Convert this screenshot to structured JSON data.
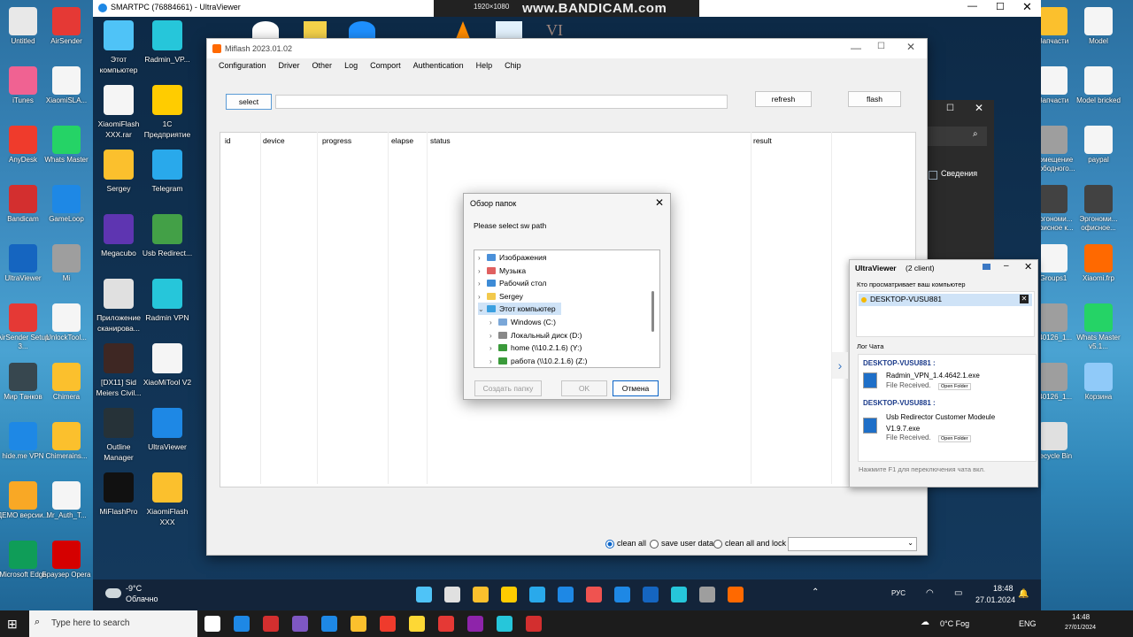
{
  "outer_desktop_left": [
    {
      "label": "Untitled",
      "color": "#e8e8e8"
    },
    {
      "label": "AirSender",
      "color": "#e53935"
    },
    {
      "label": "iTunes",
      "color": "#f06292"
    },
    {
      "label": "XiaomiSLA...",
      "color": "#f5f5f5"
    },
    {
      "label": "AnyDesk",
      "color": "#ef3b2c"
    },
    {
      "label": "Whats Master",
      "color": "#25d366"
    },
    {
      "label": "Bandicam",
      "color": "#d32f2f"
    },
    {
      "label": "GameLoop",
      "color": "#1e88e5"
    },
    {
      "label": "UltraViewer",
      "color": "#1565c0"
    },
    {
      "label": "Mi",
      "color": "#9e9e9e"
    },
    {
      "label": "AirSender Setup 3...",
      "color": "#e53935"
    },
    {
      "label": "UnlockTool...",
      "color": "#f5f5f5"
    },
    {
      "label": "Мир Танков",
      "color": "#37474f"
    },
    {
      "label": "Chimera",
      "color": "#fbc02d"
    },
    {
      "label": "hide.me VPN",
      "color": "#1e88e5"
    },
    {
      "label": "Chimerains...",
      "color": "#fbc02d"
    },
    {
      "label": "ДЕМО версии...",
      "color": "#f9a825"
    },
    {
      "label": "Mr_Auth_T...",
      "color": "#f5f5f5"
    },
    {
      "label": "Microsoft Edge",
      "color": "#0f9d58"
    },
    {
      "label": "Браузер Opera",
      "color": "#d50000"
    }
  ],
  "outer_desktop_right": [
    {
      "label": "Запчасти",
      "color": "#fbc02d"
    },
    {
      "label": "Model",
      "color": "#f5f5f5"
    },
    {
      "label": "Запчасти",
      "color": "#f5f5f5"
    },
    {
      "label": "Model bricked",
      "color": "#f5f5f5"
    },
    {
      "label": "Помещение свободного...",
      "color": "#9e9e9e"
    },
    {
      "label": "paypal",
      "color": "#f5f5f5"
    },
    {
      "label": "Эргономи... офисное к...",
      "color": "#424242"
    },
    {
      "label": "Эргономи... офисное...",
      "color": "#424242"
    },
    {
      "label": "Groups1",
      "color": "#f5f5f5"
    },
    {
      "label": "Xiaomi.frp",
      "color": "#ff6900"
    },
    {
      "label": "240126_1...",
      "color": "#9e9e9e"
    },
    {
      "label": "Whats Master v5.1...",
      "color": "#25d366"
    },
    {
      "label": "240126_1...",
      "color": "#9e9e9e"
    },
    {
      "label": "Корзина",
      "color": "#90caf9"
    },
    {
      "label": "Recycle Bin",
      "color": "#e0e0e0"
    }
  ],
  "uv_title": "SMARTPC (76884661) - UltraViewer",
  "bandicam": {
    "resolution": "1920×1080",
    "brand": "www.BANDICAM.com"
  },
  "remote_icons": [
    {
      "label": "Этот компьютер",
      "color": "#4fc3f7"
    },
    {
      "label": "Radmin_VP...",
      "color": "#26c6da"
    },
    {
      "label": "XiaomiFlash XXX.rar",
      "color": "#f5f5f5"
    },
    {
      "label": "1С Предприятие",
      "color": "#ffcc00"
    },
    {
      "label": "Sergey",
      "color": "#fbc02d"
    },
    {
      "label": "Telegram",
      "color": "#29a9eb"
    },
    {
      "label": "Megacubo",
      "color": "#5e35b1"
    },
    {
      "label": "Usb Redirect...",
      "color": "#43a047"
    },
    {
      "label": "Приложение сканирова...",
      "color": "#e0e0e0"
    },
    {
      "label": "Radmin VPN",
      "color": "#26c6da"
    },
    {
      "label": "[DX11] Sid Meiers Civil...",
      "color": "#3e2723"
    },
    {
      "label": "XiaoMiTool V2",
      "color": "#f5f5f5"
    },
    {
      "label": "Outline Manager",
      "color": "#263238"
    },
    {
      "label": "UltraViewer",
      "color": "#1e88e5"
    },
    {
      "label": "MiFlashPro",
      "color": "#111111"
    },
    {
      "label": "XiaomiFlash XXX",
      "color": "#fbc02d"
    }
  ],
  "miflash": {
    "title": "Miflash 2023.01.02",
    "menu": [
      "Configuration",
      "Driver",
      "Other",
      "Log",
      "Comport",
      "Authentication",
      "Help",
      "Chip"
    ],
    "select_label": "select",
    "path_value": "",
    "refresh_label": "refresh",
    "flash_label": "flash",
    "columns": [
      "id",
      "device",
      "progress",
      "elapse",
      "status",
      "result"
    ],
    "options": {
      "clean_all": "clean all",
      "save_user_data": "save user data",
      "clean_all_lock": "clean all and lock"
    },
    "selected_option": "clean all"
  },
  "dialog": {
    "title": "Обзор папок",
    "prompt": "Please select sw path",
    "tree": [
      {
        "label": "Изображения",
        "color": "#4a90d9",
        "indent": 0,
        "selected": false
      },
      {
        "label": "Музыка",
        "color": "#e06060",
        "indent": 0,
        "selected": false
      },
      {
        "label": "Рабочий стол",
        "color": "#3d8bd6",
        "indent": 0,
        "selected": false
      },
      {
        "label": "Sergey",
        "color": "#f2c94c",
        "indent": 0,
        "selected": false
      },
      {
        "label": "Этот компьютер",
        "color": "#3aa0e0",
        "indent": 0,
        "selected": true
      },
      {
        "label": "Windows (C:)",
        "color": "#7aa7d8",
        "indent": 1,
        "selected": false
      },
      {
        "label": "Локальный диск (D:)",
        "color": "#888888",
        "indent": 1,
        "selected": false
      },
      {
        "label": "home (\\\\10.2.1.6) (Y:)",
        "color": "#3a9a3a",
        "indent": 1,
        "selected": false
      },
      {
        "label": "работа (\\\\10.2.1.6) (Z:)",
        "color": "#3a9a3a",
        "indent": 1,
        "selected": false
      }
    ],
    "new_folder_label": "Создать папку",
    "ok_label": "OK",
    "cancel_label": "Отмена"
  },
  "uvpanel": {
    "title": "UltraViewer",
    "clients": "(2 client)",
    "viewing_label": "Кто просматривает ваш компьютер",
    "viewer": "DESKTOP-VUSU881",
    "chat_label": "Лог Чата",
    "messages": [
      {
        "sender": "DESKTOP-VUSU881 :",
        "file": "Radmin_VPN_1.4.4642.1.exe",
        "status": "File Received.",
        "action": "Open Folder"
      },
      {
        "sender": "DESKTOP-VUSU881 :",
        "file": "Usb Redirector Customer Modeule V1.9.7.exe",
        "status": "File Received.",
        "action": "Open Folder"
      }
    ],
    "hint": "Нажмите F1 для переключения чата вкл."
  },
  "bg_window": {
    "tab": "Сведения"
  },
  "remote_taskbar": {
    "weather_temp": "-9°C",
    "weather_desc": "Облачно",
    "lang": "РУС",
    "time": "18:48",
    "date": "27.01.2024"
  },
  "outer_taskbar": {
    "search_placeholder": "Type here to search",
    "weather": "0°C Fog",
    "lang": "ENG",
    "time": "14:48",
    "date": "27/01/2024"
  }
}
